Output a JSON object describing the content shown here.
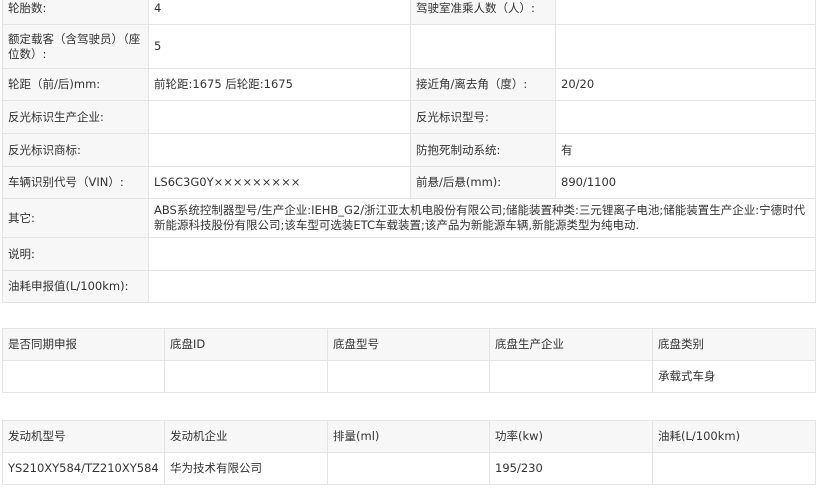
{
  "spec": {
    "rows": [
      {
        "k1": "轮胎数:",
        "v1": "4",
        "k2": "驾驶室准乘人数（人）:",
        "v2": ""
      },
      {
        "k1": "额定载客（含驾驶员）（座位数）:",
        "v1": "5",
        "k2": "",
        "v2": ""
      },
      {
        "k1": "轮距（前/后)mm:",
        "v1": "前轮距:1675 后轮距:1675",
        "k2": "接近角/离去角（度）:",
        "v2": "20/20"
      },
      {
        "k1": "反光标识生产企业:",
        "v1": "",
        "k2": "反光标识型号:",
        "v2": ""
      },
      {
        "k1": "反光标识商标:",
        "v1": "",
        "k2": "防抱死制动系统:",
        "v2": "有"
      },
      {
        "k1": "车辆识别代号（VIN）:",
        "v1": "LS6C3G0Y×××××××××",
        "k2": "前悬/后悬(mm):",
        "v2": "890/1100"
      }
    ],
    "other_label": "其它:",
    "other_value": "ABS系统控制器型号/生产企业:IEHB_G2/浙江亚太机电股份有限公司;储能装置种类:三元锂离子电池;储能装置生产企业:宁德时代新能源科技股份有限公司;该车型可选装ETC车载装置;该产品为新能源车辆,新能源类型为纯电动.",
    "note_label": "说明:",
    "note_value": "",
    "fuel_label": "油耗申报值(L/100km):",
    "fuel_value": ""
  },
  "chassis": {
    "headers": [
      "是否同期申报",
      "底盘ID",
      "底盘型号",
      "底盘生产企业",
      "底盘类别"
    ],
    "row": [
      "",
      "",
      "",
      "",
      "承载式车身"
    ]
  },
  "engine": {
    "headers": [
      "发动机型号",
      "发动机企业",
      "排量(ml)",
      "功率(kw)",
      "油耗(L/100km)"
    ],
    "row": [
      "YS210XY584/TZ210XY584",
      "华为技术有限公司",
      "",
      "195/230",
      ""
    ]
  }
}
